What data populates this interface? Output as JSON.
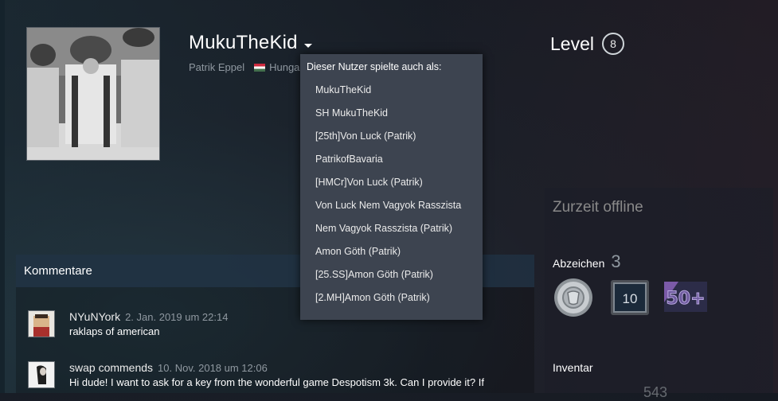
{
  "profile": {
    "persona_name": "MukuTheKid",
    "real_name": "Patrik Eppel",
    "country": "Hunga",
    "level_label": "Level",
    "level_value": "8"
  },
  "aliases": {
    "title": "Dieser Nutzer spielte auch als:",
    "items": [
      "MukuTheKid",
      "SH MukuTheKid",
      "[25th]Von Luck (Patrik)",
      "PatrikofBavaria",
      "[HMCr]Von Luck (Patrik)",
      "Von Luck Nem Vagyok Rasszista",
      "Nem Vagyok Rasszista (Patrik)",
      "Amon Göth (Patrik)",
      "[25.SS]Amon Göth (Patrik)",
      "[2.MH]Amon Göth (Patrik)"
    ]
  },
  "comments": {
    "header": "Kommentare",
    "items": [
      {
        "author": "NYuNYork",
        "date": "2. Jan. 2019 um 22:14",
        "text": "raklaps of american"
      },
      {
        "author": "swap commends",
        "date": "10. Nov. 2018 um 12:06",
        "text": "Hi dude! I want to ask for a key from the wonderful game Despotism 3k. Can I provide it? If"
      }
    ]
  },
  "sidebar": {
    "status": "Zurzeit offline",
    "badges_label": "Abzeichen",
    "badges_count": "3",
    "badge_icons": [
      "coin-badge-icon",
      "years-of-service-badge-icon",
      "fifty-plus-badge-icon"
    ],
    "badge_10_text": "10",
    "badge_50_text": "50+",
    "inventory_label": "Inventar",
    "inventory_count": "543"
  },
  "colors": {
    "dropdown_bg": "#3d4450",
    "accent_text": "#ffffff",
    "muted_text": "#8f98a0"
  }
}
